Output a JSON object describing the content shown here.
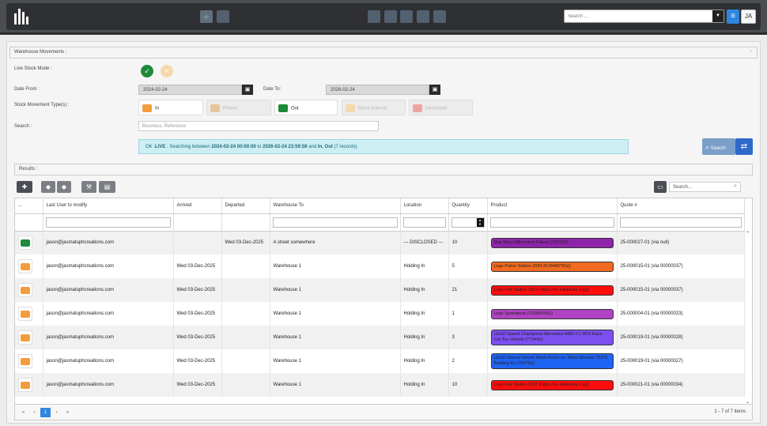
{
  "header": {
    "search_placeholder": "Search ...",
    "user_initials": "JA",
    "menu_icon": "hamburger-icon",
    "toolbar_icons": [
      "add-icon",
      "grid-icon",
      "truck-icon",
      "vehicles-icon",
      "bag-icon",
      "door-icon",
      "crown-icon"
    ]
  },
  "form": {
    "section_title": "Warehouse Movements :",
    "live_mode_label": "Live Stock Mode :",
    "date_from_label": "Date From :",
    "date_from": "2024-02-24",
    "date_to_label": "Date To:",
    "date_to": "2026-02-24",
    "types_label": "Stock Movement Type(s) :",
    "types": [
      {
        "label": "In",
        "color": "#f39c3d",
        "enabled": true
      },
      {
        "label": "Picked",
        "color": "#e9c49a",
        "enabled": false
      },
      {
        "label": "Out",
        "color": "#1f8a3a",
        "enabled": true
      },
      {
        "label": "Move Internal",
        "color": "#f5d9ad",
        "enabled": false
      },
      {
        "label": "Destroyed",
        "color": "#f0a3a3",
        "enabled": false
      }
    ],
    "search_label": "Search :",
    "search_placeholder": "Business, Reference",
    "search_button": "Search"
  },
  "info": {
    "prefix": "OK :",
    "live": "LIVE",
    "text1": " : Searching between ",
    "start": "2024-02-24 00:00:00",
    "text2": " to ",
    "end": "2026-02-24 23:59:59",
    "text3": " and ",
    "types": "In, Out",
    "count": " (7 records)"
  },
  "results": {
    "title": "Results :",
    "search_placeholder": "Search...",
    "columns": [
      "...",
      "Last User to modify",
      "Arrived",
      "Departed",
      "Warehouse To",
      "Location",
      "Quantity",
      "Product",
      "Quote #"
    ],
    "rows": [
      {
        "type": "out",
        "user": "jason@jasmatuphcreations.com",
        "arrived": "",
        "departed": "Wed 03-Dec-2025",
        "warehouse": "A street somewhere",
        "location": "--- DISCLOSED ---",
        "qty": "10",
        "product": "Star Wars Millennium Falcon (75192)()",
        "pcolor": "#8e24aa",
        "quote": "25-000027-01 (via null)"
      },
      {
        "type": "in",
        "user": "jason@jasmatuphcreations.com",
        "arrived": "Wed 03-Dec-2025",
        "departed": "",
        "warehouse": "Warehouse 1",
        "location": "Holding In",
        "qty": "5",
        "product": "Lego Police Station 2023 (K18485*00)()",
        "pcolor": "#f26b22",
        "quote": "25-000015-01 (via 00000037)"
      },
      {
        "type": "in",
        "user": "jason@jasmatuphcreations.com",
        "arrived": "Wed 03-Dec-2025",
        "departed": "",
        "warehouse": "Warehouse 1",
        "location": "Holding In",
        "qty": "21",
        "product": "Lego Fire Station 2023 (https://en.wikipedia.org)()",
        "pcolor": "#ff0d0d",
        "quote": "25-000015-01 (via 00000037)"
      },
      {
        "type": "in",
        "user": "jason@jasmatuphcreations.com",
        "arrived": "Wed 03-Dec-2025",
        "departed": "",
        "warehouse": "Warehouse 1",
        "location": "Holding In",
        "qty": "1",
        "product": "Lego Speedboat (ITEM0006)()",
        "pcolor": "#b043c2",
        "quote": "25-000004-01 (via 00000023)"
      },
      {
        "type": "in",
        "user": "jason@jasmatuphcreations.com",
        "arrived": "Wed 03-Dec-2025",
        "departed": "",
        "warehouse": "Warehouse 1",
        "location": "Holding In",
        "qty": "3",
        "product": "LEGO Speed Champions Mercedes-AMG F1 W15 Race Car Toy Vehicle (77244)()",
        "pcolor": "#7e4ff0",
        "quote": "25-000019-01 (via 00000028)"
      },
      {
        "type": "in",
        "user": "jason@jasmatuphcreations.com",
        "arrived": "Wed 03-Dec-2025",
        "departed": "",
        "warehouse": "Warehouse 1",
        "location": "Holding In",
        "qty": "2",
        "product": "LEGO Marvel Venom Mech Armor vs. Miles Morales 76276 Building Kit (76276)()",
        "pcolor": "#1f63f2",
        "quote": "25-000019-01 (via 00000027)"
      },
      {
        "type": "in",
        "user": "jason@jasmatuphcreations.com",
        "arrived": "Wed 03-Dec-2025",
        "departed": "",
        "warehouse": "Warehouse 1",
        "location": "Holding In",
        "qty": "10",
        "product": "Lego Fire Station 2021 (https://en.wikipedia.org)()",
        "pcolor": "#ff0d0d",
        "quote": "25-000021-01 (via 00000034)"
      }
    ],
    "pager": {
      "current": "1",
      "first": "«",
      "prev": "‹",
      "next": "›",
      "last": "»",
      "info": "1 - 7 of 7 items"
    },
    "scroll_up": "⌃",
    "scroll_down": "⌄"
  }
}
